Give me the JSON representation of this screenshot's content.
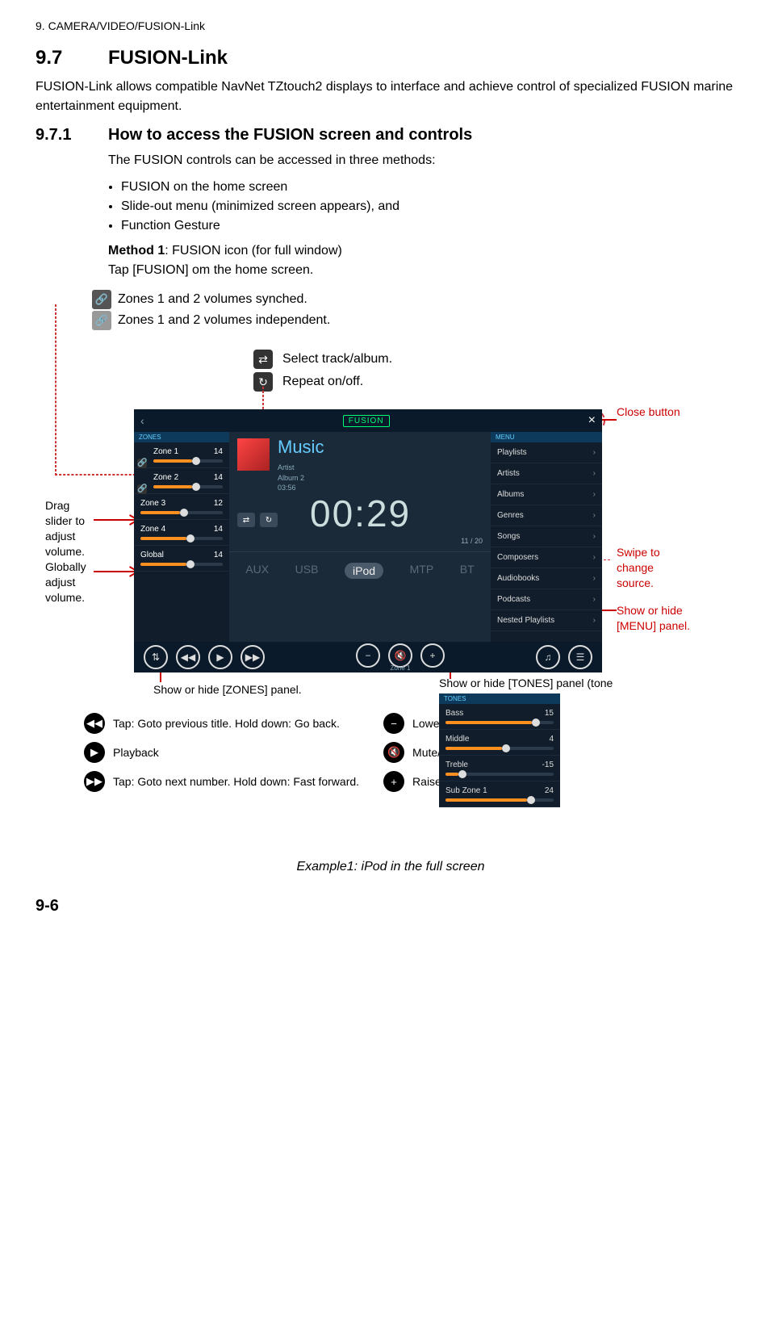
{
  "header": "9.  CAMERA/VIDEO/FUSION-Link",
  "section": {
    "num": "9.7",
    "title": "FUSION-Link",
    "intro": "FUSION-Link allows compatible NavNet TZtouch2 displays to interface and achieve control of specialized FUSION marine entertainment equipment."
  },
  "subsection": {
    "num": "9.7.1",
    "title": "How to access the FUSION screen and controls",
    "lead": "The FUSION controls can be accessed in three methods:",
    "bullets": [
      "FUSION on the home screen",
      "Slide-out menu (minimized screen appears), and",
      "Function Gesture"
    ],
    "method_label": "Method 1",
    "method_desc": ": FUSION icon (for full window)",
    "method_line2": "Tap [FUSION] om the home screen."
  },
  "legends": {
    "synched": "Zones 1 and 2 volumes synched.",
    "independent": "Zones 1 and 2 volumes independent.",
    "shuffle": "Select track/album.",
    "repeat": "Repeat on/off."
  },
  "callouts": {
    "close": "Close button",
    "drag": "Drag slider to adjust volume.",
    "global": "Globally adjust volume.",
    "swipe": "Swipe to change source.",
    "show_menu": "Show or hide [MENU] panel.",
    "show_zones": "Show or hide [ZONES] panel.",
    "show_tones": "Show or hide [TONES] panel (tone controls)."
  },
  "screenshot": {
    "music_title": "Music",
    "artist": "Artist",
    "album": "Album 2",
    "duration": "03:56",
    "time": "00:29",
    "counter": "11 / 20",
    "zones_title": "ZONES",
    "zones": [
      {
        "name": "Zone 1",
        "val": 14,
        "pct": 56
      },
      {
        "name": "Zone 2",
        "val": 14,
        "pct": 56
      },
      {
        "name": "Zone 3",
        "val": 12,
        "pct": 48
      },
      {
        "name": "Zone 4",
        "val": 14,
        "pct": 56
      },
      {
        "name": "Global",
        "val": 14,
        "pct": 56
      }
    ],
    "menu_title": "MENU",
    "menu": [
      "Playlists",
      "Artists",
      "Albums",
      "Genres",
      "Songs",
      "Composers",
      "Audiobooks",
      "Podcasts",
      "Nested Playlists"
    ],
    "sources": [
      "AUX",
      "USB",
      "iPod",
      "MTP",
      "BT"
    ],
    "active_source_index": 2,
    "bottom_zone": "Zone 1"
  },
  "controls": {
    "prev": "Tap: Goto previous title. Hold down: Go back.",
    "play": "Playback",
    "next": "Tap: Goto next number. Hold down: Fast forward.",
    "lower": "Lower volume.",
    "mute": "Mute/unmute.",
    "raise": "Raise volume."
  },
  "tones": {
    "title": "TONES",
    "rows": [
      {
        "name": "Bass",
        "val": 15,
        "pct": 80
      },
      {
        "name": "Middle",
        "val": 4,
        "pct": 52
      },
      {
        "name": "Treble",
        "val": -15,
        "pct": 12
      },
      {
        "name": "Sub Zone 1",
        "val": 24,
        "pct": 75
      }
    ]
  },
  "caption": "Example1: iPod in the full screen",
  "pagenum": "9-6"
}
